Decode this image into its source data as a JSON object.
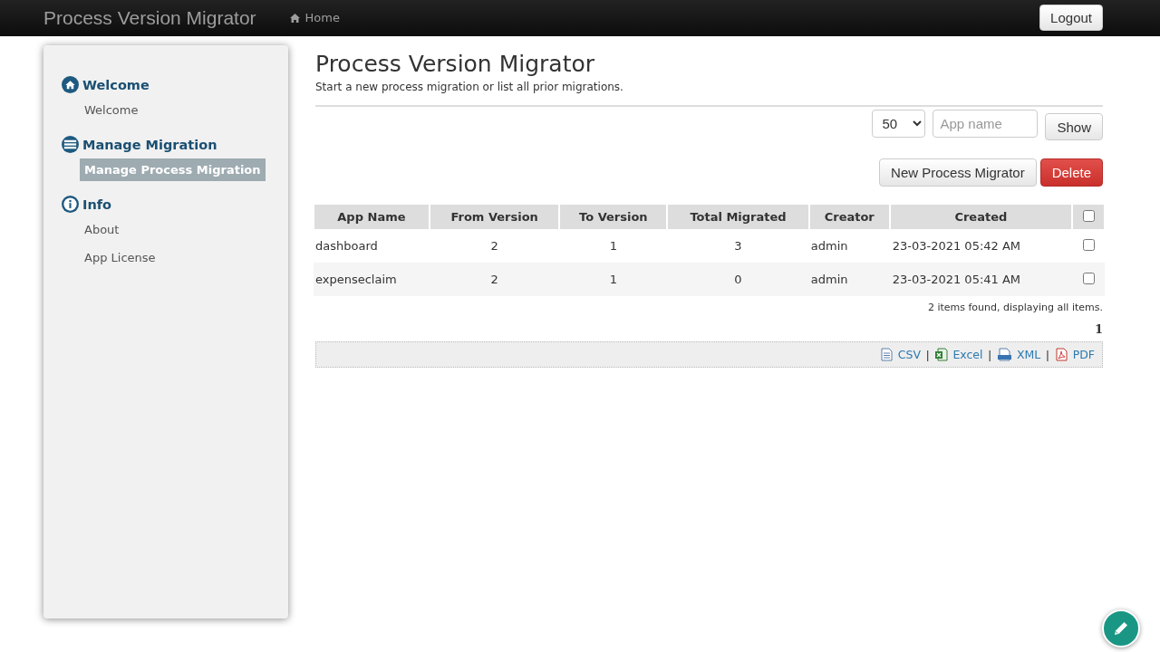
{
  "navbar": {
    "brand": "Process Version Migrator",
    "home": "Home",
    "logout": "Logout"
  },
  "sidebar": {
    "sections": [
      {
        "kind": "home",
        "title": "Welcome",
        "items": [
          {
            "label": "Welcome",
            "selected": false
          }
        ]
      },
      {
        "kind": "list",
        "title": "Manage Migration",
        "items": [
          {
            "label": "Manage Process Migration",
            "selected": true
          }
        ]
      },
      {
        "kind": "info",
        "title": "Info",
        "items": [
          {
            "label": "About",
            "selected": false
          },
          {
            "label": "App License",
            "selected": false
          }
        ]
      }
    ]
  },
  "page": {
    "title": "Process Version Migrator",
    "subtitle": "Start a new process migration or list all prior migrations."
  },
  "filters": {
    "page_size": "50",
    "app_name": {
      "placeholder": "App name"
    },
    "show": "Show"
  },
  "actions": [
    {
      "label": "New Process Migrator",
      "kind": "default"
    },
    {
      "label": "Delete",
      "kind": "danger"
    }
  ],
  "table": {
    "columns": [
      "App Name",
      "From Version",
      "To Version",
      "Total Migrated",
      "Creator",
      "Created"
    ],
    "select_all": {
      "checked": false
    },
    "rows": [
      {
        "cells": [
          "dashboard",
          "2",
          "1",
          "3",
          "admin",
          "23-03-2021 05:42 AM"
        ],
        "checked": false
      },
      {
        "cells": [
          "expenseclaim",
          "2",
          "1",
          "0",
          "admin",
          "23-03-2021 05:41 AM"
        ],
        "checked": false
      }
    ]
  },
  "summary": "2 items found, displaying all items.",
  "pagination": [
    {
      "label": "1",
      "selected": true
    }
  ],
  "exports": [
    {
      "label": "CSV",
      "kind": "csv"
    },
    {
      "label": "|",
      "kind": "separator"
    },
    {
      "label": "Excel",
      "kind": "excel"
    },
    {
      "label": "|",
      "kind": "separator"
    },
    {
      "label": "XML",
      "kind": "xml"
    },
    {
      "label": "|",
      "kind": "separator"
    },
    {
      "label": "PDF",
      "kind": "pdf"
    }
  ]
}
